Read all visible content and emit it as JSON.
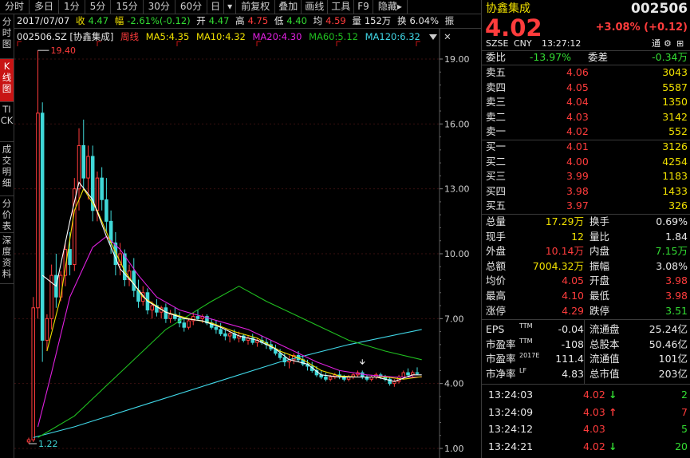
{
  "toolbar": {
    "items": [
      "分时",
      "多日",
      "1分",
      "5分",
      "15分",
      "30分",
      "60分",
      "日",
      "▾",
      "前复权",
      "叠加",
      "画线",
      "工具",
      "F9",
      "隐藏▸"
    ]
  },
  "info": {
    "date": "2017/07/07",
    "close_label": "收",
    "close": "4.47",
    "change_label": "幅",
    "change": "-2.61%(-0.12)",
    "open_label": "开",
    "open": "4.47",
    "high_label": "高",
    "high": "4.75",
    "low_label": "低",
    "low": "4.40",
    "avg_label": "均",
    "avg": "4.59",
    "volume_label": "量",
    "volume": "152万",
    "turnover_label": "换",
    "turnover": "6.04%",
    "amp_label": "振"
  },
  "left_tabs": [
    "分时图",
    "K线图",
    "TICK",
    "成交明细",
    "分价表",
    "深度资料"
  ],
  "legend": {
    "code": "002506.SZ [协鑫集成]",
    "period": "周线",
    "ma5": "MA5:4.35",
    "ma10": "MA10:4.32",
    "ma20": "MA20:4.30",
    "ma60": "MA60:5.12",
    "ma120": "MA120:6.32"
  },
  "colors": {
    "up": "#ff3c3c",
    "down": "#40d8d8",
    "ma5": "#ffffff",
    "ma10": "#f0e000",
    "ma20": "#e020e0",
    "ma60": "#20c020",
    "ma120": "#40d8e8"
  },
  "chart_data": {
    "type": "candlestick",
    "y_ticks": [
      "19.00",
      "16.00",
      "13.00",
      "10.00",
      "7.00",
      "4.00",
      "1.00"
    ],
    "ylim": [
      1.0,
      19.0
    ],
    "max_label": "19.40",
    "min_label": "1.22",
    "candles": [
      [
        1.3,
        1.5,
        1.22,
        1.4
      ],
      [
        1.4,
        8.0,
        1.3,
        7.5
      ],
      [
        7.5,
        19.4,
        7.0,
        16.5
      ],
      [
        16.5,
        17.0,
        5.0,
        6.0
      ],
      [
        6.0,
        7.2,
        5.5,
        7.0
      ],
      [
        7.0,
        9.5,
        6.5,
        9.0
      ],
      [
        9.0,
        10.0,
        7.5,
        8.0
      ],
      [
        8.0,
        9.2,
        7.8,
        9.0
      ],
      [
        9.0,
        10.5,
        8.5,
        10.2
      ],
      [
        10.2,
        11.0,
        9.0,
        9.5
      ],
      [
        9.5,
        13.5,
        9.2,
        13.0
      ],
      [
        13.0,
        15.8,
        12.0,
        15.0
      ],
      [
        15.0,
        16.2,
        13.0,
        13.5
      ],
      [
        13.5,
        15.0,
        12.5,
        14.5
      ],
      [
        14.5,
        15.0,
        11.5,
        12.0
      ],
      [
        12.0,
        13.8,
        11.5,
        13.5
      ],
      [
        13.5,
        14.0,
        12.0,
        12.5
      ],
      [
        12.5,
        13.5,
        11.0,
        11.5
      ],
      [
        11.5,
        12.0,
        10.0,
        10.5
      ],
      [
        10.5,
        11.0,
        9.0,
        9.5
      ],
      [
        9.5,
        10.5,
        9.0,
        10.0
      ],
      [
        10.0,
        10.2,
        8.5,
        8.8
      ],
      [
        8.8,
        9.5,
        8.5,
        9.2
      ],
      [
        9.2,
        9.8,
        8.0,
        8.3
      ],
      [
        8.3,
        8.8,
        7.5,
        7.8
      ],
      [
        7.8,
        8.5,
        7.6,
        8.2
      ],
      [
        8.2,
        8.4,
        7.2,
        7.4
      ],
      [
        7.4,
        7.8,
        7.0,
        7.6
      ],
      [
        7.6,
        7.9,
        7.1,
        7.3
      ],
      [
        7.3,
        7.6,
        7.0,
        7.5
      ],
      [
        7.5,
        7.7,
        6.8,
        7.0
      ],
      [
        7.0,
        7.4,
        6.8,
        7.2
      ],
      [
        7.2,
        7.5,
        6.9,
        7.0
      ],
      [
        7.0,
        7.3,
        6.6,
        6.8
      ],
      [
        6.8,
        7.0,
        6.4,
        6.6
      ],
      [
        6.6,
        7.0,
        6.5,
        6.9
      ],
      [
        6.9,
        7.3,
        6.7,
        7.1
      ],
      [
        7.1,
        7.4,
        6.9,
        7.0
      ],
      [
        7.0,
        7.2,
        6.8,
        7.1
      ],
      [
        7.1,
        7.2,
        6.7,
        6.8
      ],
      [
        6.8,
        7.0,
        6.5,
        6.6
      ],
      [
        6.6,
        6.9,
        6.3,
        6.5
      ],
      [
        6.5,
        6.8,
        6.2,
        6.3
      ],
      [
        6.3,
        6.5,
        6.0,
        6.2
      ],
      [
        6.2,
        6.4,
        5.9,
        6.3
      ],
      [
        6.3,
        6.5,
        6.0,
        6.1
      ],
      [
        6.1,
        6.4,
        5.9,
        6.2
      ],
      [
        6.2,
        6.3,
        5.9,
        6.0
      ],
      [
        6.0,
        6.2,
        5.8,
        6.1
      ],
      [
        6.1,
        6.3,
        5.8,
        5.9
      ],
      [
        5.9,
        6.1,
        5.7,
        6.0
      ],
      [
        6.0,
        6.2,
        5.8,
        5.9
      ],
      [
        5.9,
        6.1,
        5.6,
        5.8
      ],
      [
        5.8,
        6.0,
        5.5,
        5.6
      ],
      [
        5.6,
        5.8,
        5.3,
        5.4
      ],
      [
        5.4,
        5.6,
        5.1,
        5.2
      ],
      [
        5.2,
        5.4,
        4.8,
        5.0
      ],
      [
        5.0,
        5.3,
        4.7,
        5.1
      ],
      [
        5.1,
        5.4,
        4.9,
        5.3
      ],
      [
        5.3,
        5.5,
        5.0,
        5.1
      ],
      [
        5.1,
        5.3,
        4.8,
        4.9
      ],
      [
        4.9,
        5.1,
        4.6,
        4.8
      ],
      [
        4.8,
        5.0,
        4.5,
        4.6
      ],
      [
        4.6,
        4.8,
        4.3,
        4.4
      ],
      [
        4.4,
        4.6,
        4.2,
        4.3
      ],
      [
        4.3,
        4.5,
        4.1,
        4.2
      ],
      [
        4.2,
        4.4,
        4.1,
        4.3
      ],
      [
        4.3,
        4.5,
        4.2,
        4.4
      ],
      [
        4.4,
        4.6,
        4.2,
        4.3
      ],
      [
        4.3,
        4.4,
        4.1,
        4.2
      ],
      [
        4.2,
        4.4,
        4.1,
        4.3
      ],
      [
        4.3,
        4.5,
        4.2,
        4.4
      ],
      [
        4.4,
        4.6,
        4.3,
        4.5
      ],
      [
        4.5,
        4.6,
        4.2,
        4.3
      ],
      [
        4.3,
        4.4,
        4.1,
        4.2
      ],
      [
        4.2,
        4.4,
        4.1,
        4.3
      ],
      [
        4.3,
        4.5,
        4.2,
        4.4
      ],
      [
        4.4,
        4.5,
        4.2,
        4.3
      ],
      [
        4.3,
        4.4,
        4.1,
        4.2
      ],
      [
        4.2,
        4.3,
        3.9,
        4.0
      ],
      [
        4.0,
        4.2,
        3.85,
        4.1
      ],
      [
        4.1,
        4.4,
        4.0,
        4.3
      ],
      [
        4.3,
        4.6,
        4.2,
        4.5
      ],
      [
        4.5,
        4.7,
        4.3,
        4.4
      ],
      [
        4.4,
        4.6,
        4.3,
        4.5
      ],
      [
        4.5,
        4.75,
        4.4,
        4.47
      ]
    ],
    "ma5_points": [
      [
        3,
        9.0
      ],
      [
        6,
        8.5
      ],
      [
        9,
        11.5
      ],
      [
        11,
        13.3
      ],
      [
        14,
        12.5
      ],
      [
        17,
        10.8
      ],
      [
        20,
        9.3
      ],
      [
        23,
        8.6
      ],
      [
        26,
        7.8
      ],
      [
        30,
        7.3
      ],
      [
        34,
        7.0
      ],
      [
        38,
        6.9
      ],
      [
        42,
        6.6
      ],
      [
        46,
        6.2
      ],
      [
        50,
        6.0
      ],
      [
        54,
        5.6
      ],
      [
        57,
        5.1
      ],
      [
        61,
        4.9
      ],
      [
        64,
        4.4
      ],
      [
        68,
        4.3
      ],
      [
        72,
        4.3
      ],
      [
        76,
        4.3
      ],
      [
        80,
        4.1
      ],
      [
        84,
        4.4
      ],
      [
        86,
        4.4
      ]
    ],
    "ma10_points": [
      [
        4,
        5.5
      ],
      [
        7,
        8.0
      ],
      [
        10,
        12.0
      ],
      [
        12,
        13.0
      ],
      [
        15,
        12.0
      ],
      [
        18,
        10.5
      ],
      [
        21,
        9.2
      ],
      [
        25,
        8.0
      ],
      [
        30,
        7.3
      ],
      [
        35,
        7.0
      ],
      [
        40,
        6.8
      ],
      [
        45,
        6.4
      ],
      [
        50,
        6.1
      ],
      [
        55,
        5.5
      ],
      [
        60,
        5.1
      ],
      [
        64,
        4.6
      ],
      [
        68,
        4.35
      ],
      [
        72,
        4.3
      ],
      [
        78,
        4.3
      ],
      [
        82,
        4.2
      ],
      [
        86,
        4.32
      ]
    ],
    "ma20_points": [
      [
        2,
        2.0
      ],
      [
        5,
        4.5
      ],
      [
        9,
        8.0
      ],
      [
        14,
        10.3
      ],
      [
        17,
        10.8
      ],
      [
        20,
        10.2
      ],
      [
        24,
        9.0
      ],
      [
        28,
        8.0
      ],
      [
        33,
        7.4
      ],
      [
        38,
        7.1
      ],
      [
        43,
        6.8
      ],
      [
        48,
        6.5
      ],
      [
        53,
        6.0
      ],
      [
        58,
        5.5
      ],
      [
        63,
        5.0
      ],
      [
        68,
        4.6
      ],
      [
        74,
        4.4
      ],
      [
        80,
        4.3
      ],
      [
        86,
        4.3
      ]
    ],
    "ma60_points": [
      [
        2,
        1.5
      ],
      [
        10,
        2.5
      ],
      [
        20,
        4.5
      ],
      [
        30,
        6.5
      ],
      [
        40,
        7.8
      ],
      [
        46,
        8.5
      ],
      [
        52,
        7.8
      ],
      [
        60,
        7.0
      ],
      [
        70,
        6.0
      ],
      [
        78,
        5.5
      ],
      [
        86,
        5.1
      ]
    ],
    "ma120_points": [
      [
        1,
        1.5
      ],
      [
        10,
        2.0
      ],
      [
        25,
        3.0
      ],
      [
        40,
        4.0
      ],
      [
        55,
        5.0
      ],
      [
        70,
        5.8
      ],
      [
        86,
        6.5
      ]
    ]
  },
  "panel": {
    "name": "协鑫集成",
    "code": "002506",
    "price": "4.02",
    "change": "+3.08% (+0.12)",
    "exchange": "SZSE",
    "currency": "CNY",
    "time": "13:27:12",
    "tong_label": "通",
    "ratio_label": "委比",
    "ratio": "-13.97%",
    "diff_label": "委差",
    "diff": "-0.34万",
    "asks": [
      {
        "label": "卖五",
        "price": "4.06",
        "vol": "3043"
      },
      {
        "label": "卖四",
        "price": "4.05",
        "vol": "5587"
      },
      {
        "label": "卖三",
        "price": "4.04",
        "vol": "1350"
      },
      {
        "label": "卖二",
        "price": "4.03",
        "vol": "3142"
      },
      {
        "label": "卖一",
        "price": "4.02",
        "vol": "552"
      }
    ],
    "bids": [
      {
        "label": "买一",
        "price": "4.01",
        "vol": "3126"
      },
      {
        "label": "买二",
        "price": "4.00",
        "vol": "4254"
      },
      {
        "label": "买三",
        "price": "3.99",
        "vol": "1183"
      },
      {
        "label": "买四",
        "price": "3.98",
        "vol": "1433"
      },
      {
        "label": "买五",
        "price": "3.97",
        "vol": "326"
      }
    ],
    "stats": [
      {
        "l1": "总量",
        "v1": "17.29万",
        "c1": "yellow",
        "l2": "换手",
        "v2": "0.69%",
        "c2": "white"
      },
      {
        "l1": "现手",
        "v1": "12",
        "c1": "yellow",
        "l2": "量比",
        "v2": "1.84",
        "c2": "white"
      },
      {
        "l1": "外盘",
        "v1": "10.14万",
        "c1": "red",
        "l2": "内盘",
        "v2": "7.15万",
        "c2": "green"
      },
      {
        "l1": "总额",
        "v1": "7004.32万",
        "c1": "yellow",
        "l2": "振幅",
        "v2": "3.08%",
        "c2": "white"
      },
      {
        "l1": "均价",
        "v1": "4.05",
        "c1": "red",
        "l2": "开盘",
        "v2": "3.98",
        "c2": "red"
      },
      {
        "l1": "最高",
        "v1": "4.10",
        "c1": "red",
        "l2": "最低",
        "v2": "3.98",
        "c2": "red"
      },
      {
        "l1": "涨停",
        "v1": "4.29",
        "c1": "red",
        "l2": "跌停",
        "v2": "3.51",
        "c2": "green"
      }
    ],
    "fin": [
      {
        "l1": "EPS",
        "s1": "TTM",
        "v1": "-0.04",
        "l2": "流通盘",
        "v2": "25.24亿"
      },
      {
        "l1": "市盈率",
        "s1": "TTM",
        "v1": "-108",
        "l2": "总股本",
        "v2": "50.46亿"
      },
      {
        "l1": "市盈率",
        "s1": "2017E",
        "v1": "111.4",
        "l2": "流通值",
        "v2": "101亿"
      },
      {
        "l1": "市净率",
        "s1": "LF",
        "v1": "4.83",
        "l2": "总市值",
        "v2": "203亿"
      }
    ],
    "ticks": [
      {
        "time": "13:24:03",
        "price": "4.02",
        "dir": "down",
        "vol": "2"
      },
      {
        "time": "13:24:09",
        "price": "4.03",
        "dir": "up",
        "vol": "7"
      },
      {
        "time": "13:24:12",
        "price": "4.03",
        "dir": "",
        "vol": "5"
      },
      {
        "time": "13:24:21",
        "price": "4.02",
        "dir": "down",
        "vol": "20"
      }
    ]
  }
}
